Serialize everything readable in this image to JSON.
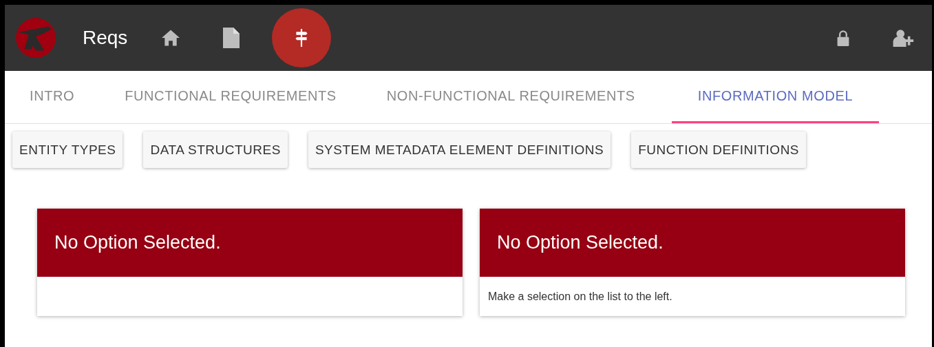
{
  "app": {
    "title": "Reqs"
  },
  "tabs": [
    {
      "label": "INTRO",
      "selected": false
    },
    {
      "label": "FUNCTIONAL REQUIREMENTS",
      "selected": false
    },
    {
      "label": "NON-FUNCTIONAL REQUIREMENTS",
      "selected": false
    },
    {
      "label": "INFORMATION MODEL",
      "selected": true
    }
  ],
  "sub_buttons": [
    "ENTITY TYPES",
    "DATA STRUCTURES",
    "SYSTEM METADATA ELEMENT DEFINITIONS",
    "FUNCTION DEFINITIONS"
  ],
  "panels": [
    {
      "heading": "No Option Selected."
    },
    {
      "heading": "No Option Selected.",
      "body": "Make a selection on the list to the left."
    }
  ]
}
